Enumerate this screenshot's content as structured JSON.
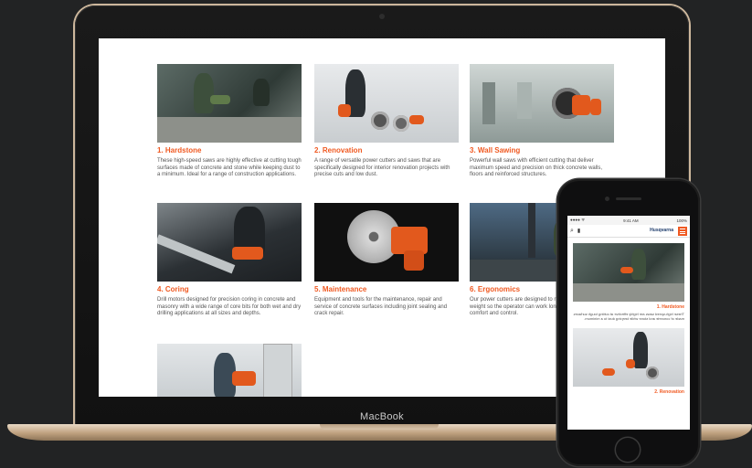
{
  "laptop": {
    "brand": "MacBook",
    "cards": [
      {
        "title": "1. Hardstone",
        "text": "These high-speed saws are highly effective at cutting tough surfaces made of concrete and stone while keeping dust to a minimum. Ideal for a range of construction applications."
      },
      {
        "title": "2. Renovation",
        "text": "A range of versatile power cutters and saws that are specifically designed for interior renovation projects with precise cuts and low dust."
      },
      {
        "title": "3. Wall Sawing",
        "text": "Powerful wall saws with efficient cutting that deliver maximum speed and precision on thick concrete walls, floors and reinforced structures."
      },
      {
        "title": "4. Coring",
        "text": "Drill motors designed for precision coring in concrete and masonry with a wide range of core bits for both wet and dry drilling applications at all sizes and depths."
      },
      {
        "title": "5. Maintenance",
        "text": "Equipment and tools for the maintenance, repair and service of concrete surfaces including joint sealing and crack repair."
      },
      {
        "title": "6. Ergonomics",
        "text": "Our power cutters are designed to reduce vibration and weight so the operator can work longer with greater comfort and control."
      },
      {
        "title": "",
        "text": ""
      }
    ]
  },
  "phone": {
    "status": {
      "carrier": "●●●● ᯤ",
      "time": "9:41 AM",
      "battery": "100%"
    },
    "logo": "Husqvarna",
    "sections": [
      {
        "title": "1. Hardstone",
        "text": "These high-speed saws are highly effective at cutting tough surfaces made of concrete and stone while keeping dust to a minimum."
      },
      {
        "title": "2. Renovation",
        "text": ""
      }
    ]
  },
  "colors": {
    "accent": "#f05a22",
    "background": "#222324"
  }
}
